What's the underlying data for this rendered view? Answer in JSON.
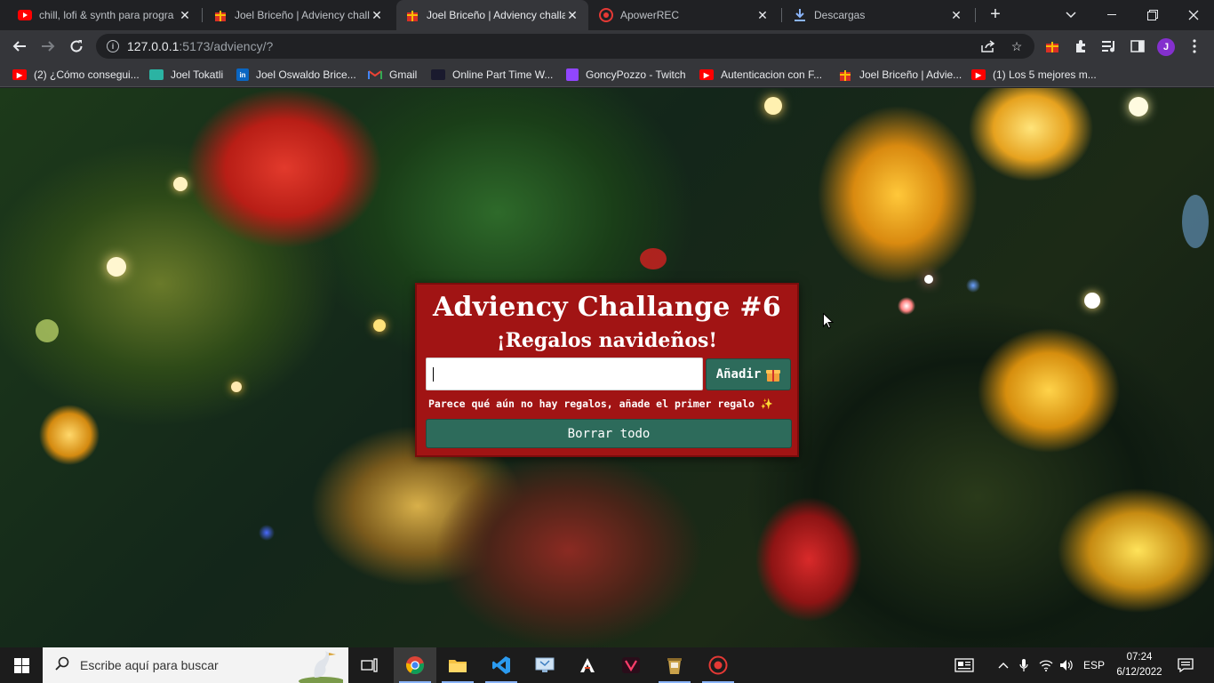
{
  "browser": {
    "tabs": [
      {
        "title": "chill, lofi & synth para progra",
        "favicon": "youtube-icon",
        "active": false
      },
      {
        "title": "Joel Briceño | Adviency challa",
        "favicon": "gift-icon",
        "active": false
      },
      {
        "title": "Joel Briceño | Adviency challa",
        "favicon": "gift-icon",
        "active": true
      },
      {
        "title": "ApowerREC",
        "favicon": "record-icon",
        "active": false
      },
      {
        "title": "Descargas",
        "favicon": "download-icon",
        "active": false
      }
    ],
    "url_host": "127.0.0.1",
    "url_path": ":5173/adviency/?",
    "profile_initial": "J",
    "bookmarks": [
      {
        "label": "(2) ¿Cómo consegui...",
        "icon": "youtube-icon"
      },
      {
        "label": "Joel Tokatli",
        "icon": "site-icon"
      },
      {
        "label": "Joel Oswaldo Brice...",
        "icon": "linkedin-icon"
      },
      {
        "label": "Gmail",
        "icon": "gmail-icon"
      },
      {
        "label": "Online Part Time W...",
        "icon": "site-icon"
      },
      {
        "label": "GoncyPozzo - Twitch",
        "icon": "twitch-icon"
      },
      {
        "label": "Autenticacion con F...",
        "icon": "youtube-icon"
      },
      {
        "label": "Joel Briceño | Advie...",
        "icon": "gift-icon"
      },
      {
        "label": "(1) Los 5 mejores m...",
        "icon": "youtube-icon"
      }
    ]
  },
  "app": {
    "title": "Adviency Challange #6",
    "subtitle": "¡Regalos navideños!",
    "input_value": "",
    "add_label": "Añadir",
    "empty_message": "Parece qué aún no hay regalos, añade el primer regalo",
    "clear_label": "Borrar todo",
    "colors": {
      "card": "#a11414",
      "button": "#2d6b5b"
    }
  },
  "taskbar": {
    "search_placeholder": "Escribe aquí para buscar",
    "language": "ESP",
    "time": "07:24",
    "date": "6/12/2022"
  }
}
